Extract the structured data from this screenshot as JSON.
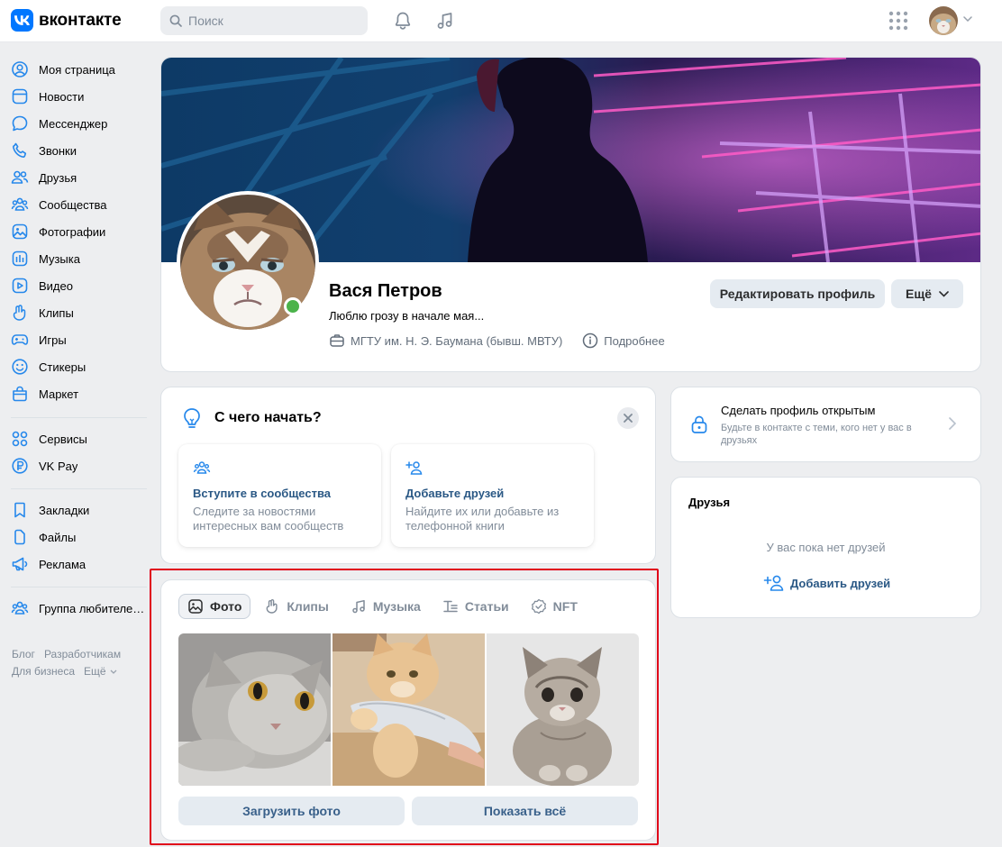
{
  "header": {
    "logo_text": "вконтакте",
    "search_placeholder": "Поиск"
  },
  "sidebar": {
    "items": [
      {
        "label": "Моя страница",
        "icon": "user-circle-icon"
      },
      {
        "label": "Новости",
        "icon": "news-icon"
      },
      {
        "label": "Мессенджер",
        "icon": "message-icon"
      },
      {
        "label": "Звонки",
        "icon": "phone-icon"
      },
      {
        "label": "Друзья",
        "icon": "friends-icon"
      },
      {
        "label": "Сообщества",
        "icon": "communities-icon"
      },
      {
        "label": "Фотографии",
        "icon": "photo-icon"
      },
      {
        "label": "Музыка",
        "icon": "music-icon"
      },
      {
        "label": "Видео",
        "icon": "video-icon"
      },
      {
        "label": "Клипы",
        "icon": "clips-icon"
      },
      {
        "label": "Игры",
        "icon": "gamepad-icon"
      },
      {
        "label": "Стикеры",
        "icon": "smile-icon"
      },
      {
        "label": "Маркет",
        "icon": "market-icon"
      },
      {
        "label": "Сервисы",
        "icon": "services-icon"
      },
      {
        "label": "VK Pay",
        "icon": "ruble-icon"
      },
      {
        "label": "Закладки",
        "icon": "bookmark-icon"
      },
      {
        "label": "Файлы",
        "icon": "file-icon"
      },
      {
        "label": "Реклама",
        "icon": "megaphone-icon"
      },
      {
        "label": "Группа любителей…",
        "icon": "group-icon"
      }
    ],
    "footer": {
      "blog": "Блог",
      "developers": "Разработчикам",
      "business": "Для бизнеса",
      "more": "Ещё"
    }
  },
  "profile": {
    "name": "Вася Петров",
    "status": "Люблю грозу в начале мая...",
    "university": "МГТУ им. Н. Э. Баумана (бывш. МВТУ)",
    "details": "Подробнее",
    "edit_label": "Редактировать профиль",
    "more_label": "Ещё"
  },
  "start": {
    "title": "С чего начать?",
    "tips": [
      {
        "title": "Вступите в сообщества",
        "desc": "Следите за новостями интересных вам сообществ"
      },
      {
        "title": "Добавьте друзей",
        "desc": "Найдите их или добавьте из телефонной книги"
      }
    ]
  },
  "media": {
    "tabs": [
      {
        "label": "Фото",
        "icon": "photo-icon"
      },
      {
        "label": "Клипы",
        "icon": "clips-icon"
      },
      {
        "label": "Музыка",
        "icon": "music-icon"
      },
      {
        "label": "Статьи",
        "icon": "article-icon"
      },
      {
        "label": "NFT",
        "icon": "nft-icon"
      }
    ],
    "upload_label": "Загрузить фото",
    "show_all_label": "Показать всё"
  },
  "open_profile": {
    "title": "Сделать профиль открытым",
    "desc": "Будьте в контакте с теми, кого нет у вас в друзьях"
  },
  "friends": {
    "title": "Друзья",
    "empty": "У вас пока нет друзей",
    "add_label": "Добавить друзей"
  },
  "colors": {
    "accent": "#0077ff",
    "link": "#2a5885",
    "online": "#4bb34b",
    "highlight": "#e0001a"
  }
}
